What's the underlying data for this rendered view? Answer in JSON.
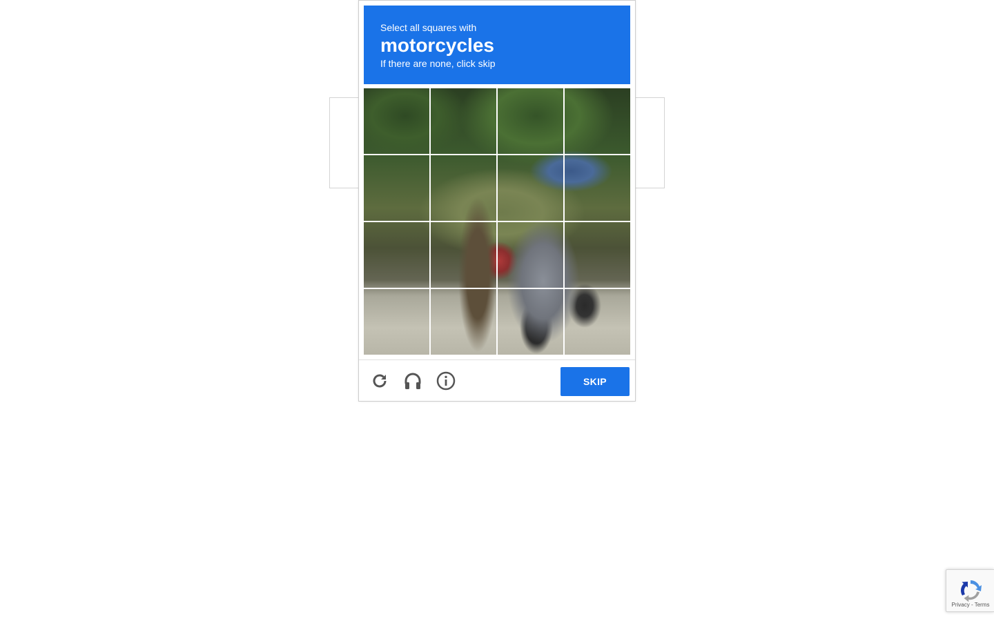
{
  "challenge": {
    "instruction_prefix": "Select all squares with",
    "keyword": "motorcycles",
    "instruction_suffix": "If there are none, click skip",
    "grid": {
      "rows": 4,
      "cols": 4,
      "tiles": [
        {
          "row": 1,
          "col": 1
        },
        {
          "row": 1,
          "col": 2
        },
        {
          "row": 1,
          "col": 3
        },
        {
          "row": 1,
          "col": 4
        },
        {
          "row": 2,
          "col": 1
        },
        {
          "row": 2,
          "col": 2
        },
        {
          "row": 2,
          "col": 3
        },
        {
          "row": 2,
          "col": 4
        },
        {
          "row": 3,
          "col": 1
        },
        {
          "row": 3,
          "col": 2
        },
        {
          "row": 3,
          "col": 3
        },
        {
          "row": 3,
          "col": 4
        },
        {
          "row": 4,
          "col": 1
        },
        {
          "row": 4,
          "col": 2
        },
        {
          "row": 4,
          "col": 3
        },
        {
          "row": 4,
          "col": 4
        }
      ]
    },
    "footer": {
      "reload_icon": "reload-icon",
      "audio_icon": "headphones-icon",
      "info_icon": "info-icon",
      "skip_label": "SKIP"
    },
    "colors": {
      "accent": "#1a73e8",
      "icon": "#555555"
    }
  },
  "badge": {
    "logo_icon": "recaptcha-logo-icon",
    "privacy_label": "Privacy",
    "separator": "-",
    "terms_label": "Terms"
  }
}
